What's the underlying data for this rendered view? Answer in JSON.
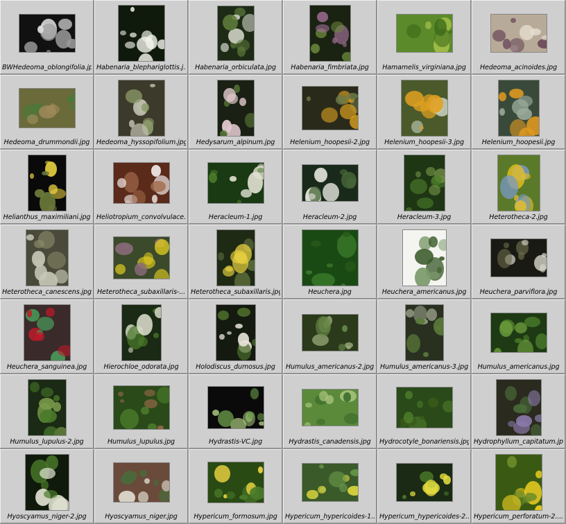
{
  "window": {
    "title": ""
  },
  "items": [
    {
      "name": "BWHedeoma_oblongifolia.jpg",
      "icon": "thumbnail-image-icon",
      "w": 80,
      "h": 54,
      "base": "#111111",
      "accents": [
        "#dcdcdc",
        "#9a9a9a"
      ]
    },
    {
      "name": "Habenaria_blephariglottis.j...",
      "icon": "thumbnail-image-icon",
      "w": 66,
      "h": 80,
      "base": "#0f1a0c",
      "accents": [
        "#f2f2ea",
        "#e8ece0"
      ]
    },
    {
      "name": "Habenaria_orbiculata.jpg",
      "icon": "thumbnail-image-icon",
      "w": 52,
      "h": 78,
      "base": "#1d2b16",
      "accents": [
        "#5e7a3a",
        "#c9ccc0"
      ]
    },
    {
      "name": "Habenaria_fimbriata.jpg",
      "icon": "thumbnail-image-icon",
      "w": 58,
      "h": 80,
      "base": "#1a2212",
      "accents": [
        "#a4709a",
        "#6a8a3a"
      ]
    },
    {
      "name": "Hamamelis_virginiana.jpg",
      "icon": "thumbnail-image-icon",
      "w": 80,
      "h": 54,
      "base": "#5a8a2a",
      "accents": [
        "#a6c24a",
        "#3c6a1a"
      ]
    },
    {
      "name": "Hedeoma_acinoides.jpg",
      "icon": "thumbnail-image-icon",
      "w": 80,
      "h": 54,
      "base": "#b8aa98",
      "accents": [
        "#6a4a5a",
        "#e6ddd0"
      ]
    },
    {
      "name": "Hedeoma_drummondii.jpg",
      "icon": "thumbnail-image-icon",
      "w": 80,
      "h": 56,
      "base": "#6a6a3a",
      "accents": [
        "#4a7a3a",
        "#a08a5a"
      ]
    },
    {
      "name": "Hedeoma_hyssopifolium.jpg",
      "icon": "thumbnail-image-icon",
      "w": 66,
      "h": 80,
      "base": "#3c3a2a",
      "accents": [
        "#8a9a6a",
        "#c0c0b0"
      ]
    },
    {
      "name": "Hedysarum_alpinum.jpg",
      "icon": "thumbnail-image-icon",
      "w": 52,
      "h": 80,
      "base": "#1a2014",
      "accents": [
        "#e0c8cc",
        "#5a7a3a"
      ]
    },
    {
      "name": "Helenium_hoopesii-2.jpg",
      "icon": "thumbnail-image-icon",
      "w": 80,
      "h": 62,
      "base": "#2a2a1a",
      "accents": [
        "#d8a020",
        "#6a7a4a"
      ]
    },
    {
      "name": "Helenium_hoopesii-3.jpg",
      "icon": "thumbnail-image-icon",
      "w": 66,
      "h": 80,
      "base": "#4a5a2a",
      "accents": [
        "#e0a020",
        "#c8d0c0"
      ]
    },
    {
      "name": "Helenium_hoopesii.jpg",
      "icon": "thumbnail-image-icon",
      "w": 58,
      "h": 80,
      "base": "#3a4a3a",
      "accents": [
        "#e09a20",
        "#9aaa9a"
      ]
    },
    {
      "name": "Helianthus_maximiliani.jpg",
      "icon": "thumbnail-image-icon",
      "w": 54,
      "h": 80,
      "base": "#0a0a0a",
      "accents": [
        "#e8d040",
        "#6a7a3a"
      ]
    },
    {
      "name": "Heliotropium_convolvulace...",
      "icon": "thumbnail-image-icon",
      "w": 80,
      "h": 58,
      "base": "#5a2a1a",
      "accents": [
        "#f0e8e8",
        "#a06a4a"
      ]
    },
    {
      "name": "Heracleum-1.jpg",
      "icon": "thumbnail-image-icon",
      "w": 80,
      "h": 58,
      "base": "#1a3a14",
      "accents": [
        "#e0e0d0",
        "#4a7a2a"
      ]
    },
    {
      "name": "Heracleum-2.jpg",
      "icon": "thumbnail-image-icon",
      "w": 80,
      "h": 52,
      "base": "#1a2a1a",
      "accents": [
        "#e4e4dc",
        "#4a6a3a"
      ]
    },
    {
      "name": "Heracleum-3.jpg",
      "icon": "thumbnail-image-icon",
      "w": 58,
      "h": 80,
      "base": "#1e3614",
      "accents": [
        "#4a7a2a",
        "#7a9a4a"
      ]
    },
    {
      "name": "Heterotheca-2.jpg",
      "icon": "thumbnail-image-icon",
      "w": 60,
      "h": 80,
      "base": "#5a7a2a",
      "accents": [
        "#e8c020",
        "#7a9ac8"
      ]
    },
    {
      "name": "Heterotheca_canescens.jpg",
      "icon": "thumbnail-image-icon",
      "w": 60,
      "h": 80,
      "base": "#4a4a3a",
      "accents": [
        "#c8c8b8",
        "#8a8a6a"
      ]
    },
    {
      "name": "Heterotheca_subaxillaris-...",
      "icon": "thumbnail-image-icon",
      "w": 80,
      "h": 60,
      "base": "#3a4a2a",
      "accents": [
        "#e8d020",
        "#8a6a7a"
      ]
    },
    {
      "name": "Heterotheca_subaxillaris.jpg",
      "icon": "thumbnail-image-icon",
      "w": 54,
      "h": 80,
      "base": "#1e2a14",
      "accents": [
        "#e8d040",
        "#5a6a3a"
      ]
    },
    {
      "name": "Heuchera.jpg",
      "icon": "thumbnail-image-icon",
      "w": 80,
      "h": 80,
      "base": "#1a4a14",
      "accents": [
        "#3a7a2a",
        "#2a5a1a"
      ]
    },
    {
      "name": "Heuchera_americanus.jpg",
      "icon": "thumbnail-image-icon",
      "w": 62,
      "h": 80,
      "base": "#f4f4f0",
      "accents": [
        "#3a5a2a",
        "#7a9a6a"
      ]
    },
    {
      "name": "Heuchera_parviflora.jpg",
      "icon": "thumbnail-image-icon",
      "w": 80,
      "h": 54,
      "base": "#1a1a14",
      "accents": [
        "#dcdcd0",
        "#6a6a4a"
      ]
    },
    {
      "name": "Heuchera_sanguinea.jpg",
      "icon": "thumbnail-image-icon",
      "w": 66,
      "h": 80,
      "base": "#3a2a2a",
      "accents": [
        "#c01a2a",
        "#4a9a5a"
      ]
    },
    {
      "name": "Hierochloe_odorata.jpg",
      "icon": "thumbnail-image-icon",
      "w": 56,
      "h": 80,
      "base": "#1a2a14",
      "accents": [
        "#e0e0d0",
        "#4a7a2a"
      ]
    },
    {
      "name": "Holodiscus_dumosus.jpg",
      "icon": "thumbnail-image-icon",
      "w": 56,
      "h": 80,
      "base": "#141a10",
      "accents": [
        "#e8e4d8",
        "#4a6a2a"
      ]
    },
    {
      "name": "Humulus_americanus-2.jpg",
      "icon": "thumbnail-image-icon",
      "w": 80,
      "h": 52,
      "base": "#2a3a1a",
      "accents": [
        "#6a8a4a",
        "#a0b080"
      ]
    },
    {
      "name": "Humulus_americanus-3.jpg",
      "icon": "thumbnail-image-icon",
      "w": 54,
      "h": 80,
      "base": "#2a3020",
      "accents": [
        "#5a7a3a",
        "#9aa08a"
      ]
    },
    {
      "name": "Humulus_americanus.jpg",
      "icon": "thumbnail-image-icon",
      "w": 80,
      "h": 56,
      "base": "#1e3a14",
      "accents": [
        "#4a7a2a",
        "#6a9a3a"
      ]
    },
    {
      "name": "Humulus_lupulus-2.jpg",
      "icon": "thumbnail-image-icon",
      "w": 54,
      "h": 80,
      "base": "#1a2a14",
      "accents": [
        "#4a7a2a",
        "#7a9a4a"
      ]
    },
    {
      "name": "Humulus_lupulus.jpg",
      "icon": "thumbnail-image-icon",
      "w": 80,
      "h": 62,
      "base": "#2a4a1a",
      "accents": [
        "#9a6a4a",
        "#4a7a2a"
      ]
    },
    {
      "name": "Hydrastis-VC.jpg",
      "icon": "thumbnail-image-icon",
      "w": 80,
      "h": 60,
      "base": "#0a0a0a",
      "accents": [
        "#6a9a4a",
        "#a6c27a"
      ]
    },
    {
      "name": "Hydrastis_canadensis.jpg",
      "icon": "thumbnail-image-icon",
      "w": 80,
      "h": 52,
      "base": "#5a8a3a",
      "accents": [
        "#a6c27a",
        "#3a6a2a"
      ]
    },
    {
      "name": "Hydrocotyle_bonariensis.jpg",
      "icon": "thumbnail-image-icon",
      "w": 80,
      "h": 58,
      "base": "#2a4a1a",
      "accents": [
        "#4a7a2a",
        "#3a5a1a"
      ]
    },
    {
      "name": "Hydrophyllum_capitatum.jpg",
      "icon": "thumbnail-image-icon",
      "w": 64,
      "h": 80,
      "base": "#2a2a1e",
      "accents": [
        "#8a7aaa",
        "#4a6a3a"
      ]
    },
    {
      "name": "Hyoscyamus_niger-2.jpg",
      "icon": "thumbnail-image-icon",
      "w": 62,
      "h": 80,
      "base": "#101a0c",
      "accents": [
        "#4a7a2a",
        "#e0e0d0"
      ]
    },
    {
      "name": "Hyoscyamus_niger.jpg",
      "icon": "thumbnail-image-icon",
      "w": 80,
      "h": 56,
      "base": "#6a4a3a",
      "accents": [
        "#4a6a3a",
        "#e0dcd0"
      ]
    },
    {
      "name": "Hypericum_formosum.jpg",
      "icon": "thumbnail-image-icon",
      "w": 80,
      "h": 58,
      "base": "#2a4a14",
      "accents": [
        "#4a7a2a",
        "#e8d040"
      ]
    },
    {
      "name": "Hypericum_hypericoides-1...",
      "icon": "thumbnail-image-icon",
      "w": 80,
      "h": 54,
      "base": "#3a5a2a",
      "accents": [
        "#6a9a4a",
        "#e8e040"
      ]
    },
    {
      "name": "Hypericum_hypericoides-2...",
      "icon": "thumbnail-image-icon",
      "w": 80,
      "h": 54,
      "base": "#1a2a14",
      "accents": [
        "#e8e040",
        "#4a7a2a"
      ]
    },
    {
      "name": "Hypericum_perforatum-2....",
      "icon": "thumbnail-image-icon",
      "w": 66,
      "h": 80,
      "base": "#3a5a14",
      "accents": [
        "#f0d020",
        "#6a8a2a"
      ]
    }
  ]
}
